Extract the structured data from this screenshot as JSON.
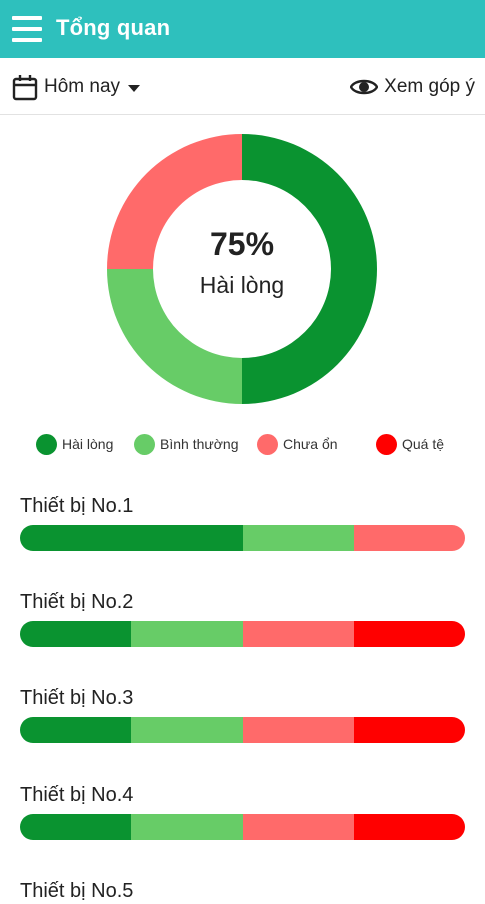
{
  "header": {
    "title": "Tổng quan",
    "menu_icon": "hamburger-menu-icon"
  },
  "toolbar": {
    "date_filter": "Hôm nay",
    "date_icon": "calendar-icon",
    "dropdown_icon": "caret-down-icon",
    "feedback_label": "Xem góp ý",
    "feedback_icon": "eye-icon"
  },
  "summary": {
    "percent": "75%",
    "label": "Hài lòng"
  },
  "colors": {
    "hai_long": "#0a9330",
    "binh_thuong": "#67cc67",
    "chua_on": "#ff6a6a",
    "qua_te": "#ff0000",
    "header": "#2ec0bd"
  },
  "legend": [
    {
      "label": "Hài lòng",
      "color": "#0a9330"
    },
    {
      "label": "Bình thường",
      "color": "#67cc67"
    },
    {
      "label": "Chưa ổn",
      "color": "#ff6a6a"
    },
    {
      "label": "Quá tệ",
      "color": "#ff0000"
    }
  ],
  "chart_data": {
    "type": "pie",
    "categories": [
      "Hài lòng",
      "Bình thường",
      "Chưa ổn",
      "Quá tệ"
    ],
    "values": [
      50,
      25,
      25,
      0
    ],
    "center_text": "75%",
    "center_label": "Hài lòng"
  },
  "devices": [
    {
      "name": "Thiết bị No.1",
      "shares": [
        50,
        25,
        25,
        0
      ]
    },
    {
      "name": "Thiết bị No.2",
      "shares": [
        25,
        25,
        25,
        25
      ]
    },
    {
      "name": "Thiết bị No.3",
      "shares": [
        25,
        25,
        25,
        25
      ]
    },
    {
      "name": "Thiết bị No.4",
      "shares": [
        25,
        25,
        25,
        25
      ]
    },
    {
      "name": "Thiết bị No.5",
      "shares": []
    }
  ]
}
